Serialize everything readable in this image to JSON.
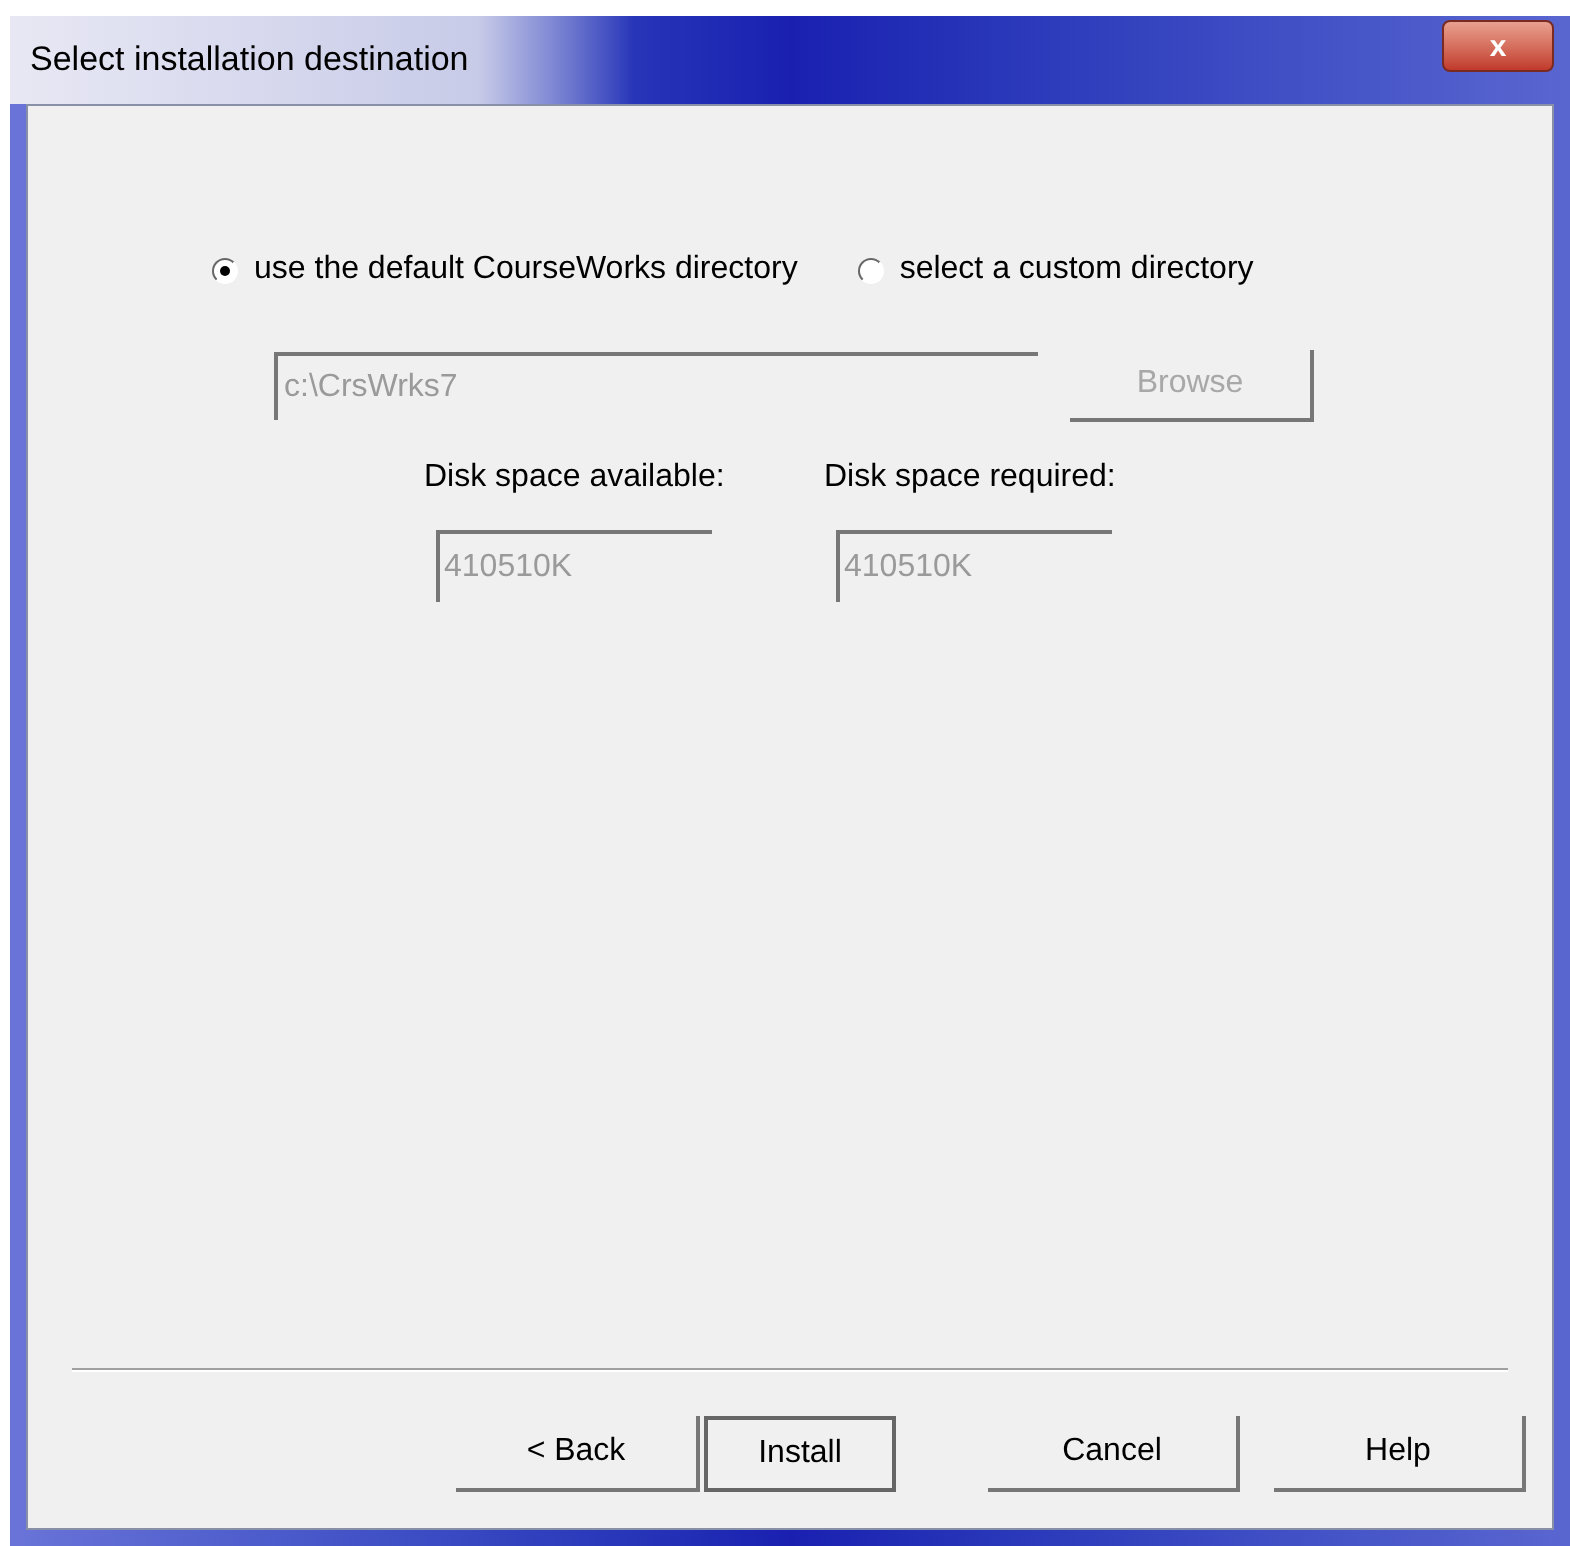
{
  "window": {
    "title": "Select installation destination",
    "close": "x"
  },
  "options": [
    {
      "label": "use the default CourseWorks directory",
      "selected": true
    },
    {
      "label": "select a custom directory",
      "selected": false
    }
  ],
  "directory": {
    "value": "c:\\CrsWrks7",
    "disabled": true
  },
  "browse": {
    "label": "Browse",
    "disabled": true
  },
  "disk": [
    {
      "label": "Disk space available:",
      "value": "410510K",
      "disabled": true
    },
    {
      "label": "Disk space required:",
      "value": "410510K",
      "disabled": true
    }
  ],
  "buttons": [
    {
      "label": "< Back",
      "default": false
    },
    {
      "label": "Install",
      "default": true
    },
    {
      "label": "Cancel",
      "default": false
    },
    {
      "label": "Help",
      "default": false
    }
  ]
}
